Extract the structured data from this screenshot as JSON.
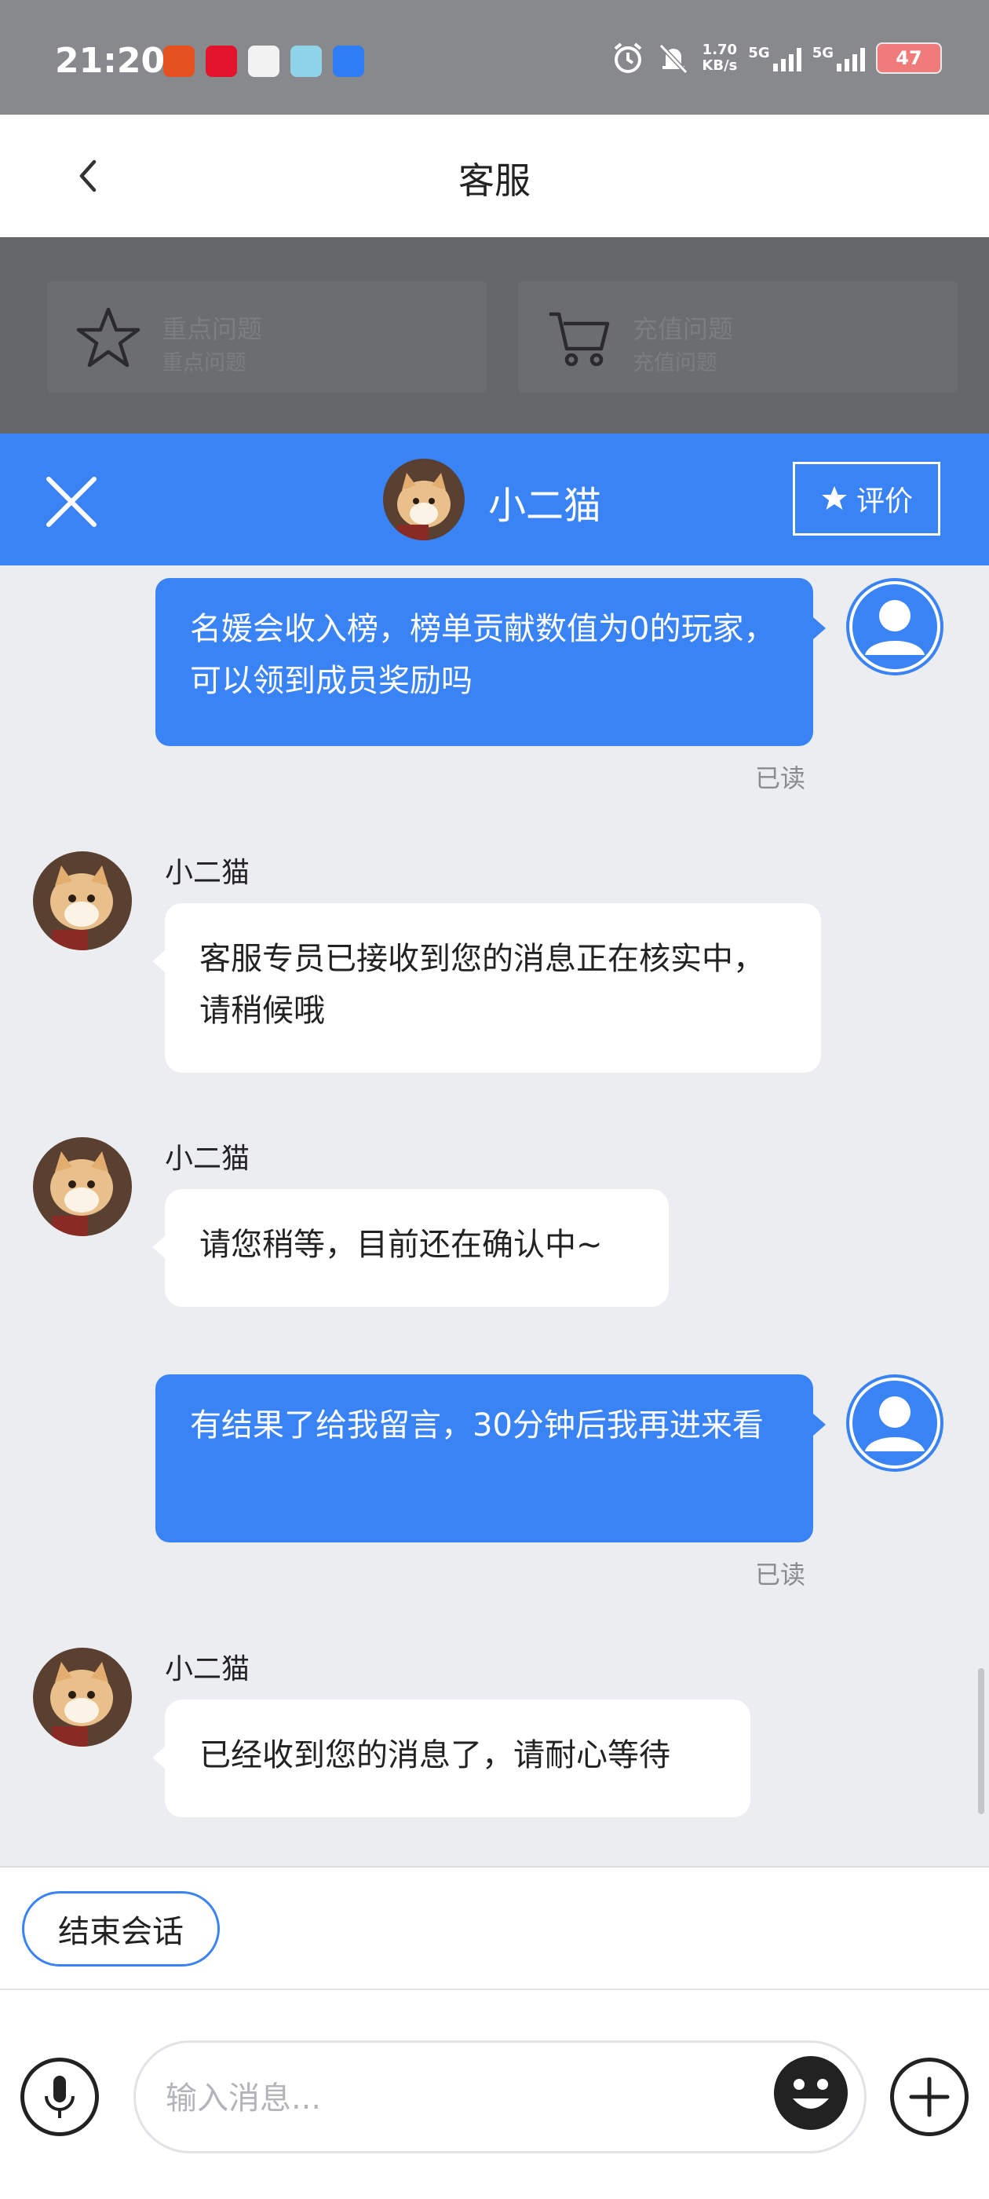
{
  "status_bar": {
    "time": "21:20",
    "net_speed_value": "1.70",
    "net_speed_unit": "KB/s",
    "sim1": "5G",
    "sim2": "5G",
    "battery": "47",
    "icons": [
      "alarm-icon",
      "mute-icon",
      "signal-icon",
      "signal-icon"
    ]
  },
  "title_bar": {
    "title": "客服",
    "back_icon": "chevron-left-icon"
  },
  "quick_menu": [
    {
      "title": "重点问题",
      "subtitle": "重点问题",
      "icon": "star-icon"
    },
    {
      "title": "充值问题",
      "subtitle": "充值问题",
      "icon": "cart-icon"
    }
  ],
  "chat_header": {
    "agent_name": "小二猫",
    "rate_label": "评价",
    "close_icon": "close-icon"
  },
  "messages": [
    {
      "from": "user",
      "text": "名媛会收入榜，榜单贡献数值为0的玩家，可以领到成员奖励吗",
      "status": "已读"
    },
    {
      "from": "agent",
      "sender": "小二猫",
      "text": "客服专员已接收到您的消息正在核实中，请稍候哦"
    },
    {
      "from": "agent",
      "sender": "小二猫",
      "text": "请您稍等，目前还在确认中~"
    },
    {
      "from": "user",
      "text": "有结果了给我留言，30分钟后我再进来看",
      "status": "已读"
    },
    {
      "from": "agent",
      "sender": "小二猫",
      "text": "已经收到您的消息了，请耐心等待"
    }
  ],
  "end_session_label": "结束会话",
  "input": {
    "placeholder": "输入消息..."
  },
  "colors": {
    "accent": "#3a83f5",
    "background": "#ecedf0",
    "overlay": "#666769"
  }
}
